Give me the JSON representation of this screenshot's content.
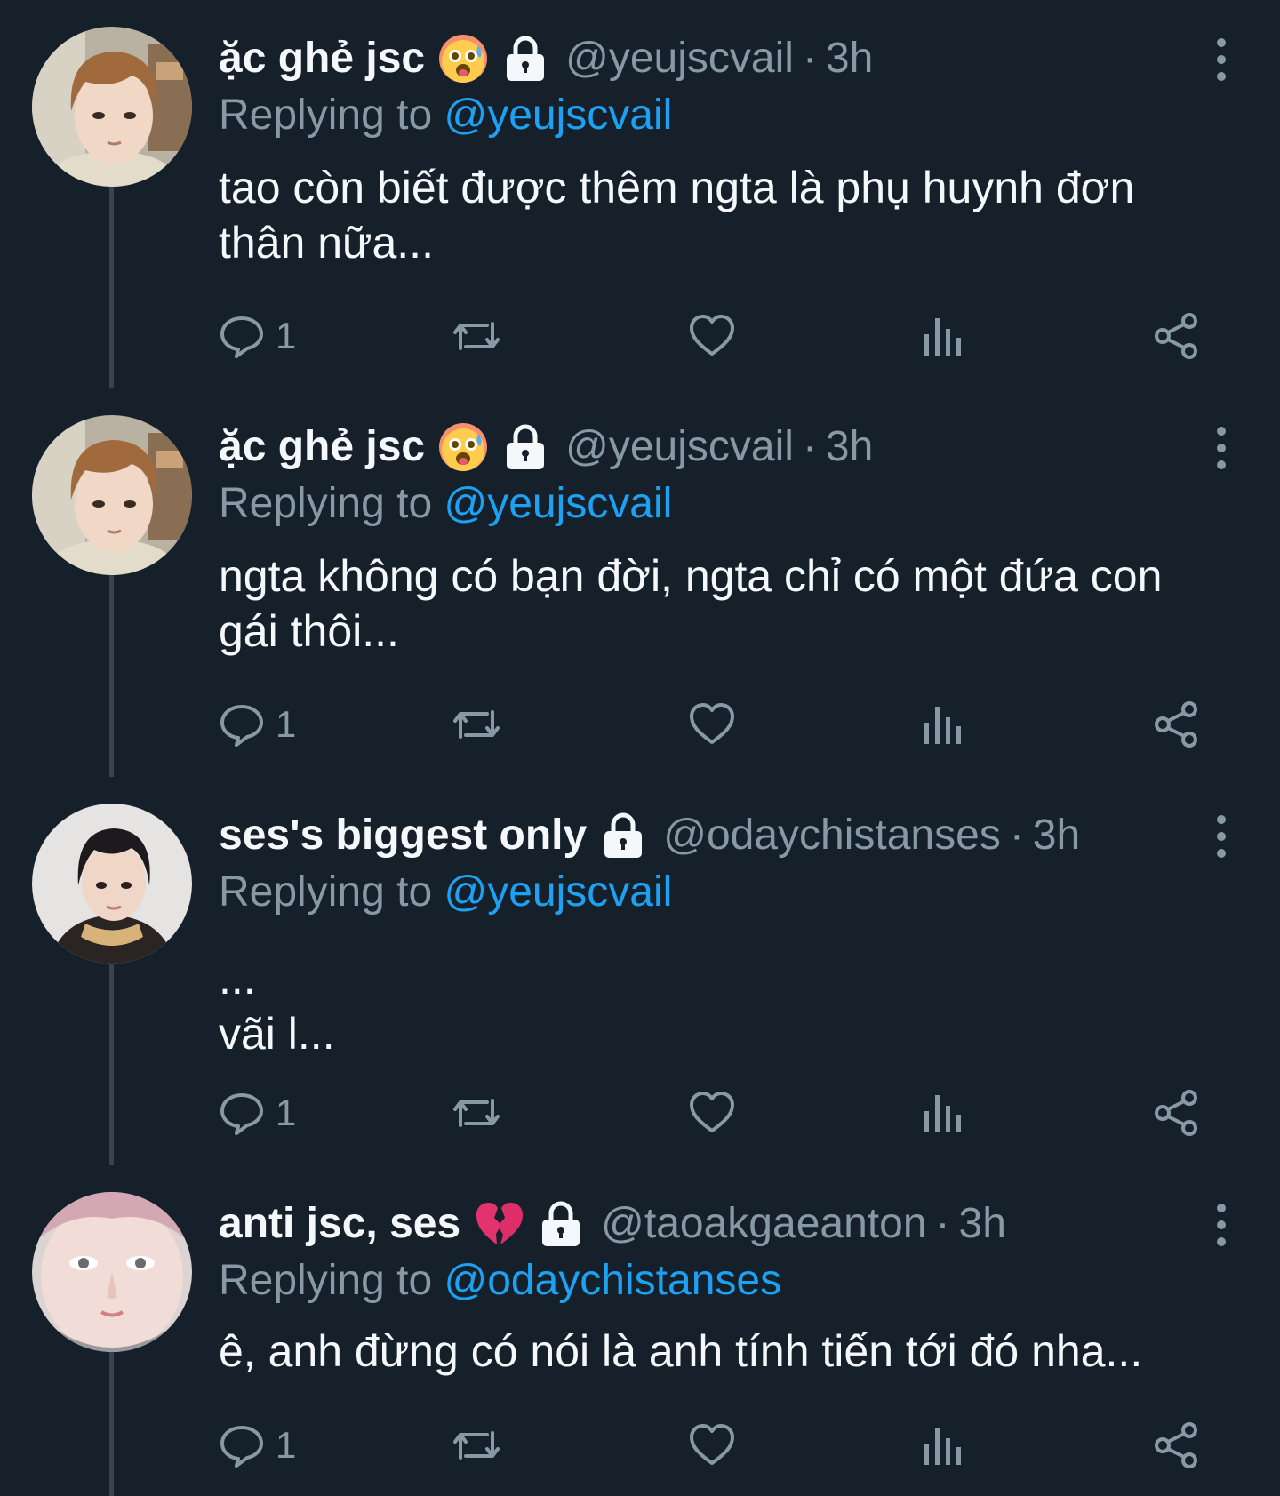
{
  "colors": {
    "background": "#15202b",
    "text_primary": "#f5f8fa",
    "text_secondary": "#8899a6",
    "mention": "#1da1f2",
    "thread_line": "#38444d"
  },
  "tweets": [
    {
      "display_name": "ặc ghẻ jsc",
      "name_emoji": "flushed-hot-face-emoji",
      "protected_icon": "lock-icon",
      "handle": "@yeujscvail",
      "separator": "·",
      "time": "3h",
      "replying_prefix": "Replying to ",
      "replying_to": "@yeujscvail",
      "text": "tao còn biết được thêm ngta là phụ huynh đơn\nthân nữa...",
      "reply_count": "1"
    },
    {
      "display_name": "ặc ghẻ jsc",
      "name_emoji": "flushed-hot-face-emoji",
      "protected_icon": "lock-icon",
      "handle": "@yeujscvail",
      "separator": "·",
      "time": "3h",
      "replying_prefix": "Replying to ",
      "replying_to": "@yeujscvail",
      "text": "ngta không có bạn đời, ngta chỉ có một đứa con\ngái thôi...",
      "reply_count": "1"
    },
    {
      "display_name": "ses's biggest only",
      "protected_icon": "lock-icon",
      "handle": "@odaychistanses",
      "separator": "·",
      "time": "3h",
      "replying_prefix": "Replying to ",
      "replying_to": "@yeujscvail",
      "text": "...\nvãi l...",
      "reply_count": "1"
    },
    {
      "display_name": "anti jsc, ses",
      "name_emoji": "broken-heart-emoji",
      "protected_icon": "lock-icon",
      "handle": "@taoakgaeanton",
      "separator": "·",
      "time": "3h",
      "replying_prefix": "Replying to ",
      "replying_to": "@odaychistanses",
      "text": "ê, anh đừng có nói là anh tính tiến tới đó nha...",
      "reply_count": "1"
    }
  ],
  "action_icons": [
    "reply-icon",
    "retweet-icon",
    "like-icon",
    "analytics-icon",
    "share-icon"
  ]
}
